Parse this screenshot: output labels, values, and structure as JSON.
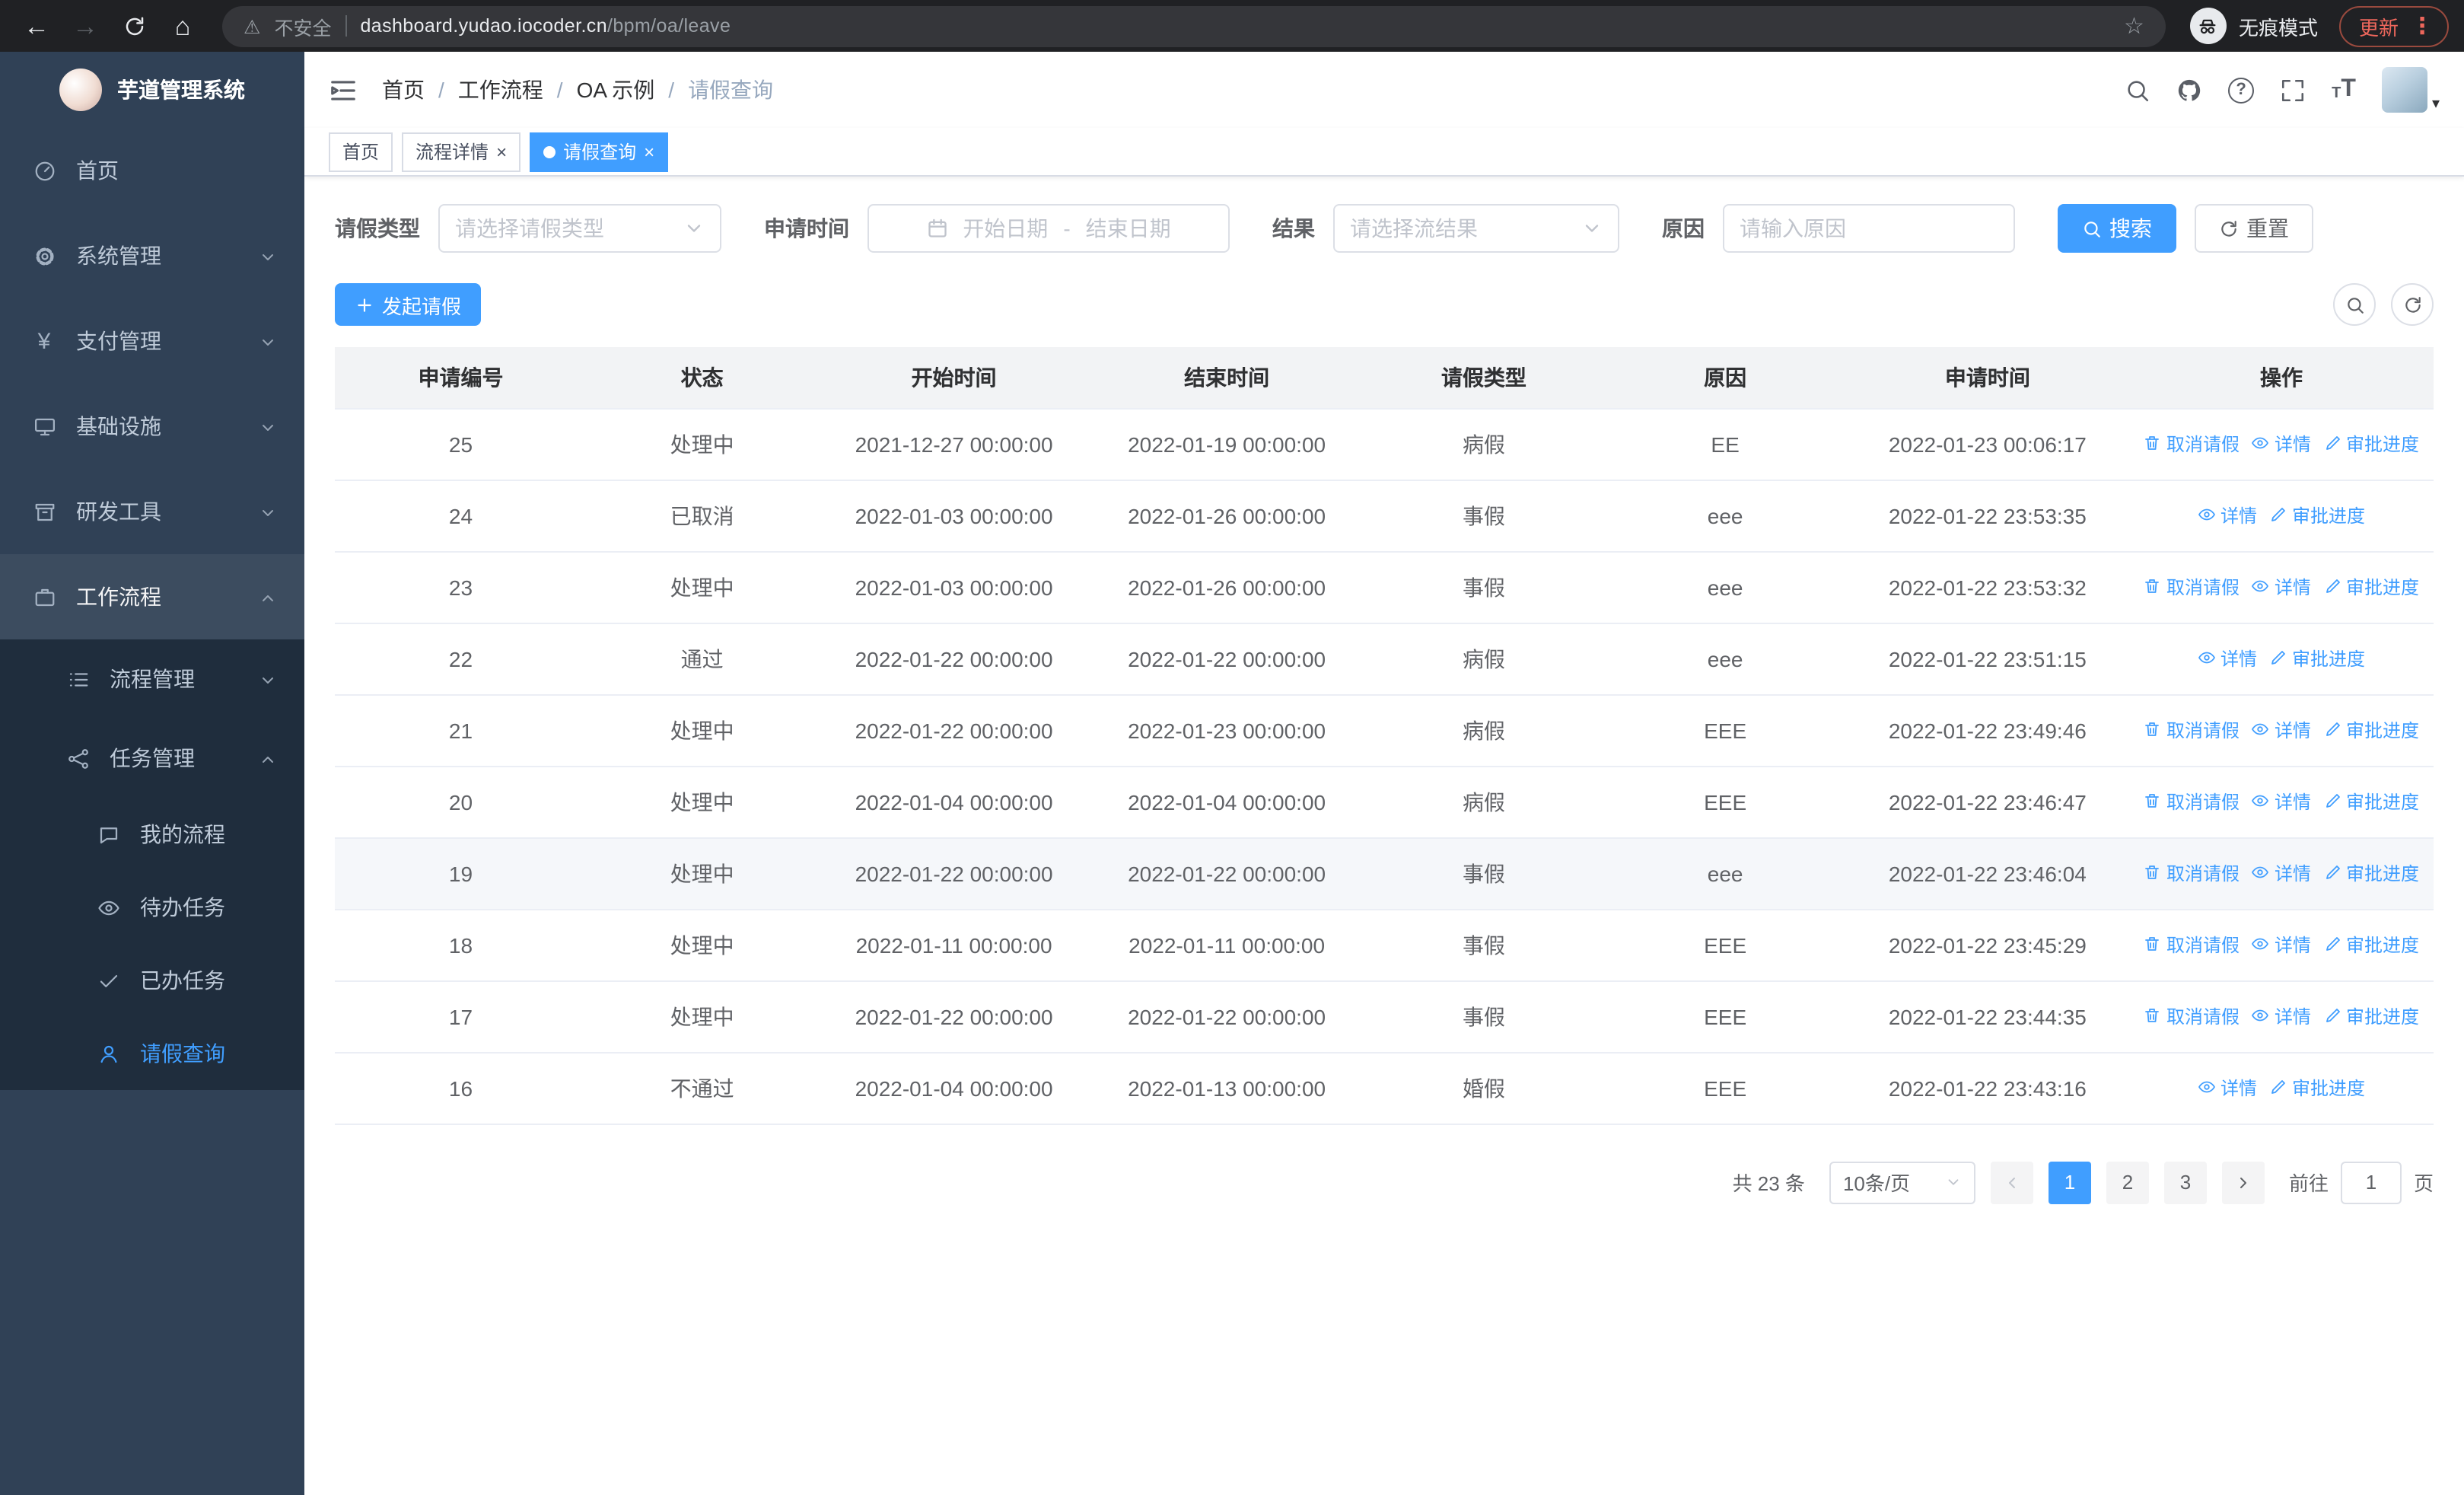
{
  "theme": {
    "primary": "#409eff",
    "sidebar_bg": "#304156",
    "submenu_bg": "#1f2d3d"
  },
  "icons": {
    "back_arrow": "←",
    "forward_arrow": "→",
    "home": "⌂",
    "warning": "⚠",
    "star": "☆",
    "kebab_menu": "⋮",
    "yen": "¥",
    "question": "?",
    "close": "×",
    "caret_down": "▾",
    "font_size_large": "T",
    "font_size_small": "T"
  },
  "browser": {
    "security_label": "不安全",
    "url_host": "dashboard.yudao.iocoder.cn",
    "url_path": "/bpm/oa/leave",
    "incognito_label": "无痕模式",
    "update_label": "更新"
  },
  "sidebar": {
    "title": "芋道管理系统",
    "items": [
      {
        "label": "首页"
      },
      {
        "label": "系统管理"
      },
      {
        "label": "支付管理"
      },
      {
        "label": "基础设施"
      },
      {
        "label": "研发工具"
      },
      {
        "label": "工作流程"
      },
      {
        "label": "流程管理"
      },
      {
        "label": "任务管理"
      },
      {
        "label": "我的流程"
      },
      {
        "label": "待办任务"
      },
      {
        "label": "已办任务"
      },
      {
        "label": "请假查询"
      }
    ]
  },
  "breadcrumb": {
    "separator": "/",
    "items": [
      "首页",
      "工作流程",
      "OA 示例",
      "请假查询"
    ]
  },
  "tabs": [
    {
      "label": "首页"
    },
    {
      "label": "流程详情"
    },
    {
      "label": "请假查询"
    }
  ],
  "filters": {
    "leave_type_label": "请假类型",
    "leave_type_placeholder": "请选择请假类型",
    "apply_time_label": "申请时间",
    "date_start_placeholder": "开始日期",
    "date_separator": "-",
    "date_end_placeholder": "结束日期",
    "result_label": "结果",
    "result_placeholder": "请选择流结果",
    "reason_label": "原因",
    "reason_placeholder": "请输入原因",
    "search_button": "搜索",
    "reset_button": "重置"
  },
  "toolbar": {
    "create_button": "发起请假"
  },
  "table": {
    "columns": [
      "申请编号",
      "状态",
      "开始时间",
      "结束时间",
      "请假类型",
      "原因",
      "申请时间",
      "操作"
    ],
    "actions": {
      "cancel": "取消请假",
      "detail": "详情",
      "progress": "审批进度"
    },
    "rows": [
      {
        "id": "25",
        "status": "处理中",
        "start": "2021-12-27 00:00:00",
        "end": "2022-01-19 00:00:00",
        "type": "病假",
        "reason": "EE",
        "applied": "2022-01-23 00:06:17",
        "cancellable": true,
        "highlighted": false
      },
      {
        "id": "24",
        "status": "已取消",
        "start": "2022-01-03 00:00:00",
        "end": "2022-01-26 00:00:00",
        "type": "事假",
        "reason": "eee",
        "applied": "2022-01-22 23:53:35",
        "cancellable": false,
        "highlighted": false
      },
      {
        "id": "23",
        "status": "处理中",
        "start": "2022-01-03 00:00:00",
        "end": "2022-01-26 00:00:00",
        "type": "事假",
        "reason": "eee",
        "applied": "2022-01-22 23:53:32",
        "cancellable": true,
        "highlighted": false
      },
      {
        "id": "22",
        "status": "通过",
        "start": "2022-01-22 00:00:00",
        "end": "2022-01-22 00:00:00",
        "type": "病假",
        "reason": "eee",
        "applied": "2022-01-22 23:51:15",
        "cancellable": false,
        "highlighted": false
      },
      {
        "id": "21",
        "status": "处理中",
        "start": "2022-01-22 00:00:00",
        "end": "2022-01-23 00:00:00",
        "type": "病假",
        "reason": "EEE",
        "applied": "2022-01-22 23:49:46",
        "cancellable": true,
        "highlighted": false
      },
      {
        "id": "20",
        "status": "处理中",
        "start": "2022-01-04 00:00:00",
        "end": "2022-01-04 00:00:00",
        "type": "病假",
        "reason": "EEE",
        "applied": "2022-01-22 23:46:47",
        "cancellable": true,
        "highlighted": false
      },
      {
        "id": "19",
        "status": "处理中",
        "start": "2022-01-22 00:00:00",
        "end": "2022-01-22 00:00:00",
        "type": "事假",
        "reason": "eee",
        "applied": "2022-01-22 23:46:04",
        "cancellable": true,
        "highlighted": true
      },
      {
        "id": "18",
        "status": "处理中",
        "start": "2022-01-11 00:00:00",
        "end": "2022-01-11 00:00:00",
        "type": "事假",
        "reason": "EEE",
        "applied": "2022-01-22 23:45:29",
        "cancellable": true,
        "highlighted": false
      },
      {
        "id": "17",
        "status": "处理中",
        "start": "2022-01-22 00:00:00",
        "end": "2022-01-22 00:00:00",
        "type": "事假",
        "reason": "EEE",
        "applied": "2022-01-22 23:44:35",
        "cancellable": true,
        "highlighted": false
      },
      {
        "id": "16",
        "status": "不通过",
        "start": "2022-01-04 00:00:00",
        "end": "2022-01-13 00:00:00",
        "type": "婚假",
        "reason": "EEE",
        "applied": "2022-01-22 23:43:16",
        "cancellable": false,
        "highlighted": false
      }
    ]
  },
  "pagination": {
    "total_label": "共 23 条",
    "page_size_label": "10条/页",
    "pages": [
      "1",
      "2",
      "3"
    ],
    "active_page": "1",
    "goto_label": "前往",
    "goto_value": "1",
    "unit_label": "页"
  }
}
